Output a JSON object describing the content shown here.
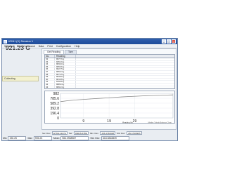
{
  "window": {
    "title": "IONH (V) Session 1"
  },
  "menu": [
    "Session",
    "Send Command",
    "Data",
    "Print",
    "Configuration",
    "Help"
  ],
  "left": {
    "reading": "921.23 G",
    "status": "Collecting"
  },
  "tabs": [
    {
      "label": "Get Reading"
    },
    {
      "label": "Tare"
    }
  ],
  "table": {
    "headers": [
      "No.",
      "Reading"
    ],
    "rows": [
      [
        "32",
        "997.76 g"
      ],
      [
        "33",
        "925.19 g"
      ],
      [
        "34",
        "983.40 g"
      ],
      [
        "35",
        "905.06 g"
      ],
      [
        "36",
        "902.75 g"
      ],
      [
        "37",
        "905.23 g"
      ],
      [
        "38",
        "907.15 g"
      ],
      [
        "39",
        "903.66 g"
      ],
      [
        "40",
        "901.06 g"
      ],
      [
        "41",
        "919.06 g"
      ],
      [
        "42",
        "908.43 g"
      ],
      [
        "43",
        "909.13 g"
      ]
    ]
  },
  "chart_data": {
    "type": "line",
    "ytick_labels": [
      "982",
      "785.6",
      "589.2",
      "392.8",
      "196.4",
      "0"
    ],
    "xtick_labels": [
      "9",
      "19",
      "29"
    ],
    "xlabel": "Reading No.",
    "annotation": "Mettler Toledo Balance Chart",
    "ylim": [
      0,
      982
    ],
    "xlim": [
      0,
      44
    ],
    "x": [
      0,
      3,
      6,
      9,
      12,
      15,
      18,
      21,
      24,
      27,
      30,
      33,
      36,
      39,
      42,
      44
    ],
    "y": [
      650,
      690,
      720,
      740,
      760,
      780,
      800,
      820,
      840,
      855,
      870,
      885,
      895,
      905,
      915,
      921
    ]
  },
  "info": [
    {
      "label": "Ser. Dev.",
      "value": "ETKE-1227H"
    },
    {
      "label": "Ser.",
      "value": "89625-67BH"
    },
    {
      "label": "Min. Dev.",
      "value": "256.4760938"
    },
    {
      "label": "Std. Dev.",
      "value": "256.7609965"
    }
  ],
  "stats": [
    {
      "label": "Min",
      "value": "196.25"
    },
    {
      "label": "Max",
      "value": "995.23"
    },
    {
      "label": "Mean",
      "value": "984.0968987"
    },
    {
      "label": "Std. Dev.",
      "value": "664.0848839"
    }
  ],
  "colors": {
    "titlebar": "#2f5fae",
    "line": "#8a8a8a",
    "status_bg": "#f3f1d0"
  }
}
